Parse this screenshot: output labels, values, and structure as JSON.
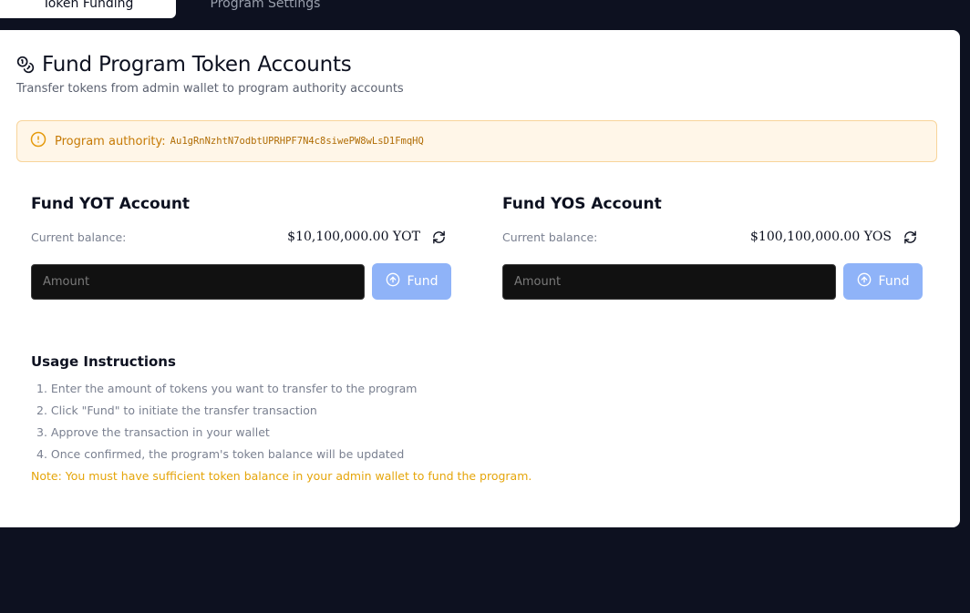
{
  "tabs": [
    {
      "label": "Token Funding",
      "active": true
    },
    {
      "label": "Program Settings",
      "active": false
    }
  ],
  "header": {
    "title": "Fund Program Token Accounts",
    "title_icon": "coins-icon",
    "subtitle": "Transfer tokens from admin wallet to program authority accounts"
  },
  "alert": {
    "icon": "info-icon",
    "label": "Program authority:",
    "address": "Au1gRnNzhtN7odbtUPRHPF7N4c8siwePW8wLsD1FmqHQ"
  },
  "fund_yot": {
    "title": "Fund YOT Account",
    "balance_label": "Current balance:",
    "balance_value": "$10,100,000.00 YOT",
    "refresh_icon": "refresh-icon",
    "input_placeholder": "Amount",
    "button_label": "Fund",
    "button_icon": "arrow-up-circle-icon"
  },
  "fund_yos": {
    "title": "Fund YOS Account",
    "balance_label": "Current balance:",
    "balance_value": "$100,100,000.00 YOS",
    "refresh_icon": "refresh-icon",
    "input_placeholder": "Amount",
    "button_label": "Fund",
    "button_icon": "arrow-up-circle-icon"
  },
  "usage": {
    "title": "Usage Instructions",
    "steps": [
      "1. Enter the amount of tokens you want to transfer to the program",
      "2. Click \"Fund\" to initiate the transfer transaction",
      "3. Approve the transaction in your wallet",
      "4. Once confirmed, the program's token balance will be updated"
    ],
    "note": "Note: You must have sufficient token balance in your admin wallet to fund the program."
  },
  "colors": {
    "background": "#0d1120",
    "card": "#ffffff",
    "alert_bg": "#fff6e8",
    "alert_text": "#c67a05",
    "fund_button": "#8fb3f8",
    "note_text": "#e5a50a"
  }
}
